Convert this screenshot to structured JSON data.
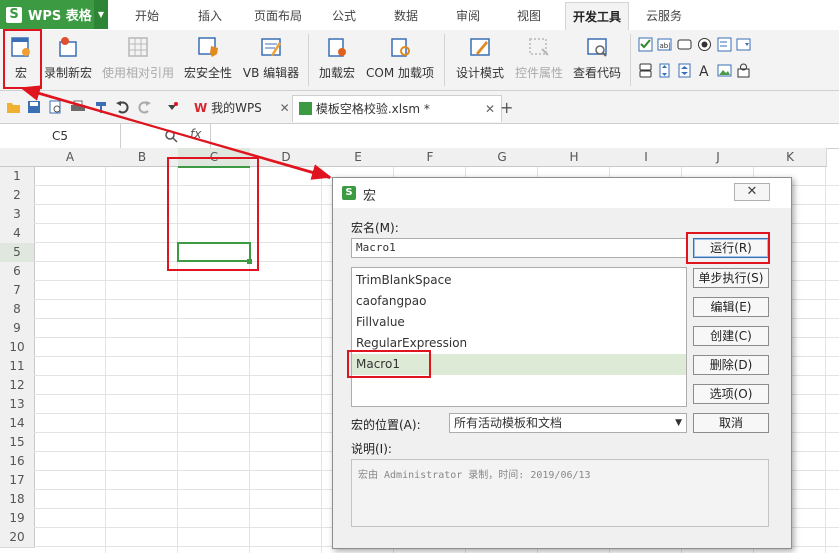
{
  "app": {
    "logo": "S",
    "name": "WPS 表格"
  },
  "menu": [
    "开始",
    "插入",
    "页面布局",
    "公式",
    "数据",
    "审阅",
    "视图",
    "开发工具",
    "云服务"
  ],
  "ribbon": {
    "macro": "宏",
    "record": "录制新宏",
    "relative": "使用相对引用",
    "security": "宏安全性",
    "vb": "VB 编辑器",
    "addin": "加载宏",
    "com": "COM 加载项",
    "design": "设计模式",
    "props": "控件属性",
    "code": "查看代码"
  },
  "tabs": {
    "home": "我的WPS",
    "file": "模板空格校验.xlsm *",
    "new": "+"
  },
  "formula": {
    "cell": "C5",
    "fx": "fx"
  },
  "columns": [
    "A",
    "B",
    "C",
    "D",
    "E",
    "F",
    "G",
    "H",
    "I",
    "J",
    "K"
  ],
  "rows": [
    "1",
    "2",
    "3",
    "4",
    "5",
    "6",
    "7",
    "8",
    "9",
    "10",
    "11",
    "12",
    "13",
    "14",
    "15",
    "16",
    "17",
    "18",
    "19",
    "20"
  ],
  "dialog": {
    "title": "宏",
    "name_label": "宏名(M):",
    "name_value": "Macro1",
    "macros": [
      "TrimBlankSpace",
      "caofangpao",
      "Fillvalue",
      "RegularExpression",
      "Macro1"
    ],
    "buttons": [
      "运行(R)",
      "单步执行(S)",
      "编辑(E)",
      "创建(C)",
      "删除(D)",
      "选项(O)",
      "取消"
    ],
    "location_label": "宏的位置(A):",
    "location_value": "所有活动模板和文档",
    "desc_label": "说明(I):",
    "desc_value": "宏由 Administrator 录制，时间: 2019/06/13"
  },
  "colors": {
    "accent": "#3c9a43",
    "highlight": "#e0141e",
    "selection": "#dcead6"
  }
}
